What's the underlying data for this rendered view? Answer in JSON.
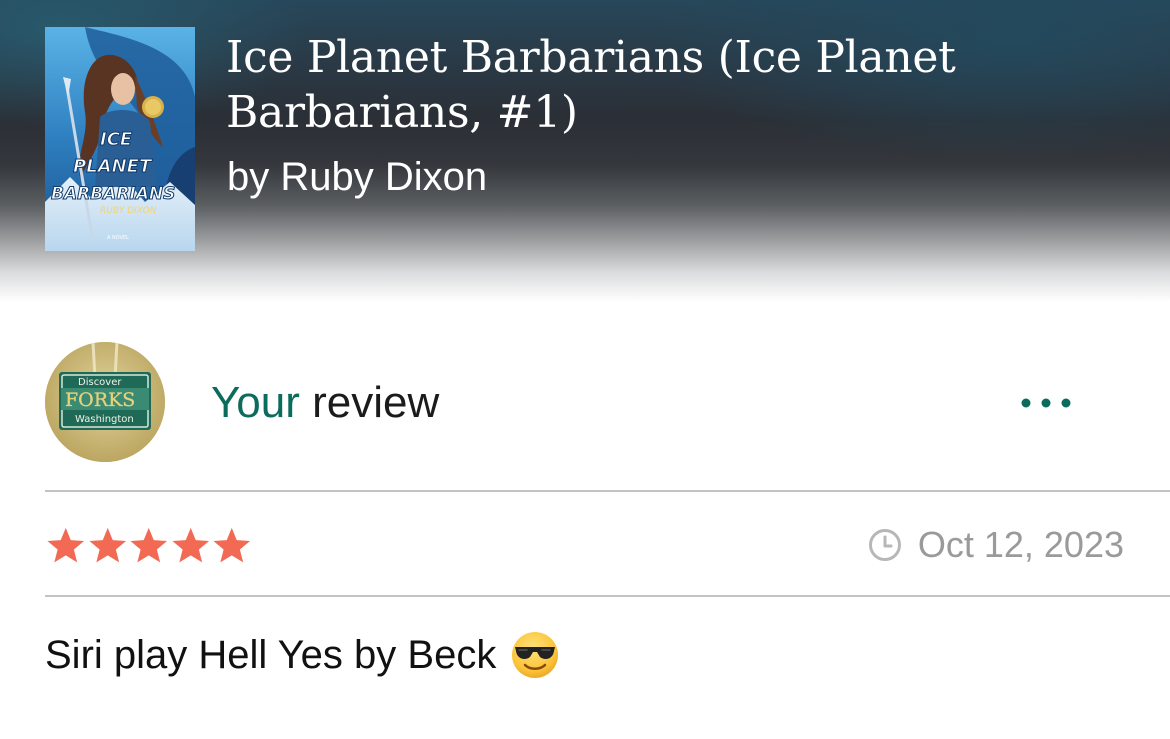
{
  "book": {
    "title": "Ice Planet Barbarians (Ice Planet Barbarians, #1)",
    "author": "by Ruby Dixon",
    "cover_text": {
      "line1": "ICE",
      "line2": "PLANET",
      "line3": "BARBARIANS",
      "author": "RUBY DIXON",
      "tag": "A NOVEL"
    }
  },
  "avatar": {
    "sign_line1": "Discover",
    "sign_line2": "FORKS",
    "sign_line3": "Washington"
  },
  "review": {
    "heading_accent": "Your",
    "heading_rest": " review",
    "rating": 5,
    "max_rating": 5,
    "date": "Oct 12, 2023",
    "text": "Siri play Hell Yes by Beck",
    "emoji": "smiling-face-with-sunglasses"
  },
  "icons": {
    "more": "more-horizontal-icon",
    "clock": "clock-icon",
    "star": "star-icon"
  },
  "colors": {
    "accent": "#0b6b5c",
    "star": "#f26a53",
    "muted": "#9a9a9a",
    "divider": "#c3c3c3"
  }
}
